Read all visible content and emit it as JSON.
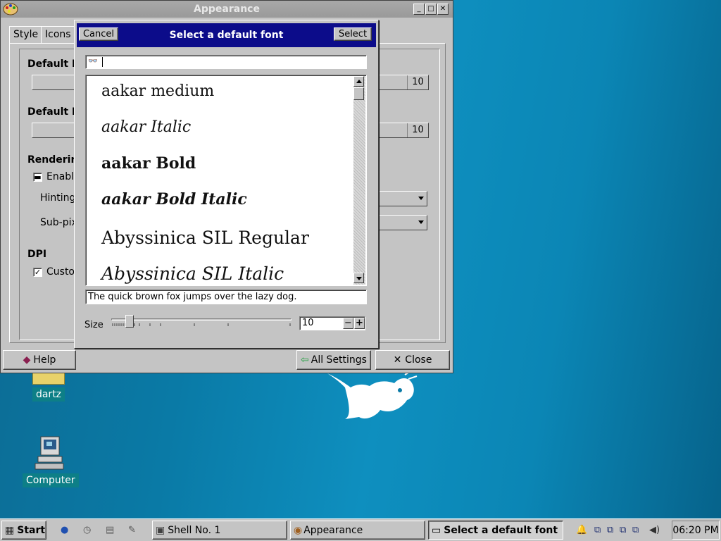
{
  "appearance": {
    "title": "Appearance",
    "tabs": [
      "Style",
      "Icons"
    ],
    "default_font_label": "Default F",
    "default_font_size": "10",
    "default_mono_label": "Default M",
    "default_mono_size": "10",
    "rendering_label": "Renderin",
    "enable_label": "Enable",
    "hinting_label": "Hinting",
    "subpixel_label": "Sub-pix",
    "dpi_label": "DPI",
    "custom_label": "Custo",
    "help_button": "Help",
    "all_settings_button": "All Settings",
    "close_button": "Close"
  },
  "font_dialog": {
    "title": "Select a default font",
    "cancel_button": "Cancel",
    "select_button": "Select",
    "search_value": "",
    "fonts": [
      {
        "name": "aakar  medium",
        "style": "normal"
      },
      {
        "name": "aakar  Italic",
        "style": "italic"
      },
      {
        "name": "aakar  Bold",
        "style": "bold"
      },
      {
        "name": "aakar  Bold  Italic",
        "style": "bold-italic"
      },
      {
        "name": "Abyssinica  SIL  Regular",
        "style": "normal"
      },
      {
        "name": "Abyssinica  SIL  Italic",
        "style": "italic"
      }
    ],
    "preview_text": "The quick brown fox jumps over the lazy dog.",
    "size_label": "Size",
    "size_value": "10",
    "size_slider_fraction": 0.08
  },
  "desktop": {
    "icons": [
      {
        "label": "dartz"
      },
      {
        "label": "Computer"
      }
    ]
  },
  "taskbar": {
    "start_label": "Start",
    "tasks": [
      {
        "label": "Shell No. 1"
      },
      {
        "label": "Appearance"
      },
      {
        "label": "Select a default font"
      }
    ],
    "clock": "06:20 PM"
  }
}
